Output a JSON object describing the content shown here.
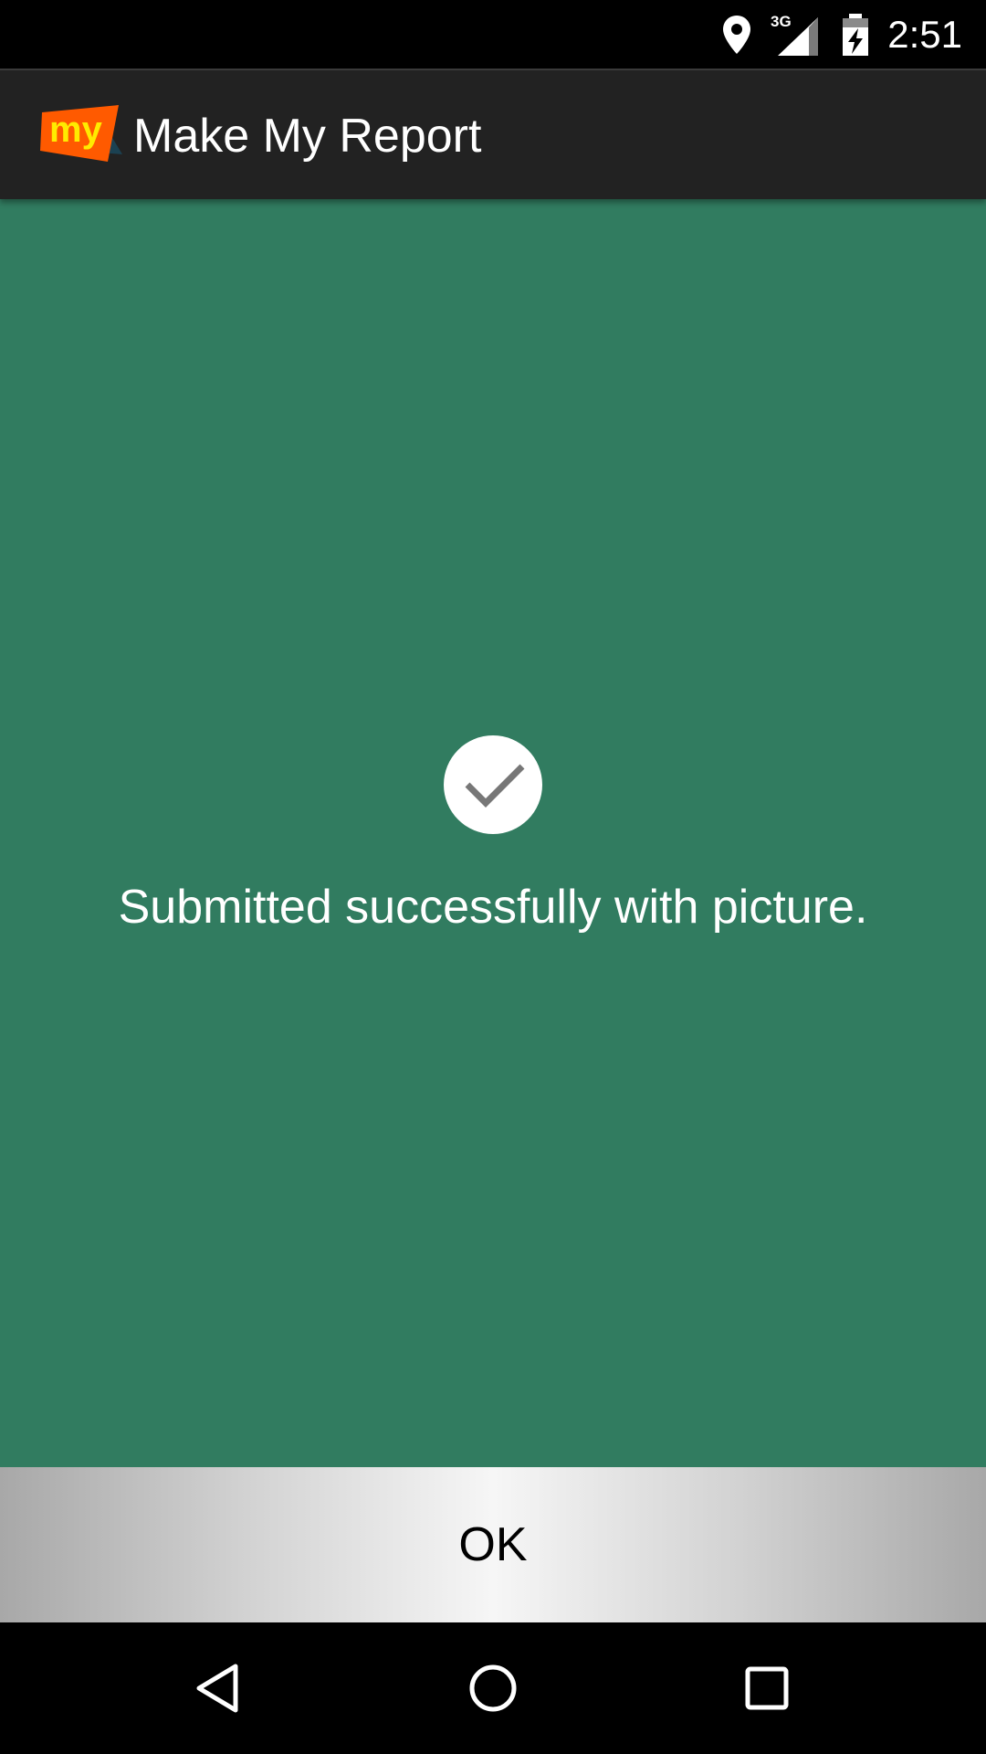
{
  "status_bar": {
    "network_label": "3G",
    "time": "2:51",
    "icons": [
      "location-icon",
      "signal-icon",
      "battery-charging-icon"
    ]
  },
  "action_bar": {
    "logo_text": "my",
    "title": "Make My Report"
  },
  "content": {
    "icon": "checkmark-icon",
    "message": "Submitted successfully with picture."
  },
  "ok_button": {
    "label": "OK"
  },
  "nav_bar": {
    "icons": [
      "back-icon",
      "home-icon",
      "recents-icon"
    ]
  },
  "colors": {
    "content_background": "#317c60",
    "action_bar_background": "#222222",
    "logo_orange": "#ff5a00",
    "logo_text": "#ffeb00"
  }
}
